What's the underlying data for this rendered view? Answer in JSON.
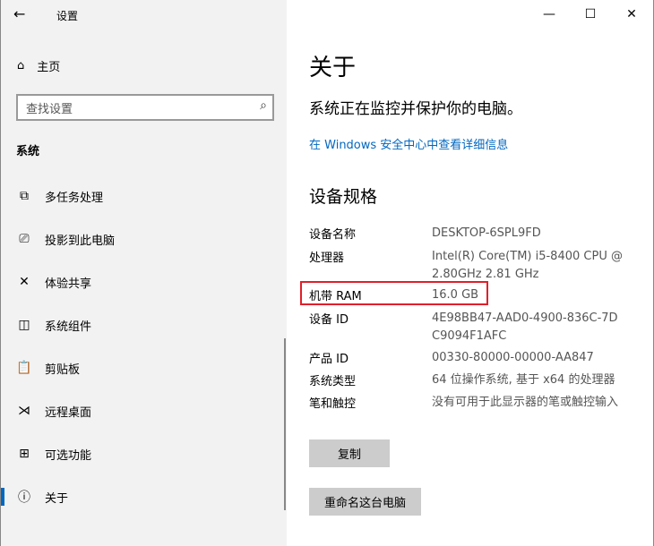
{
  "window": {
    "title": "设置",
    "back_icon": "arrow-left-icon",
    "minimize": "—",
    "maximize": "☐",
    "close": "✕"
  },
  "sidebar": {
    "home": "主页",
    "search_placeholder": "查找设置",
    "section": "系统",
    "items": [
      {
        "label": "多任务处理",
        "icon": "multitask-icon",
        "glyph": "⧉"
      },
      {
        "label": "投影到此电脑",
        "icon": "project-icon",
        "glyph": "⎚"
      },
      {
        "label": "体验共享",
        "icon": "share-icon",
        "glyph": "✕"
      },
      {
        "label": "系统组件",
        "icon": "components-icon",
        "glyph": "◫"
      },
      {
        "label": "剪贴板",
        "icon": "clipboard-icon",
        "glyph": "📋"
      },
      {
        "label": "远程桌面",
        "icon": "remote-icon",
        "glyph": "⋊"
      },
      {
        "label": "可选功能",
        "icon": "features-icon",
        "glyph": "⊞"
      },
      {
        "label": "关于",
        "icon": "info-icon",
        "glyph": "ⓘ"
      }
    ]
  },
  "main": {
    "title": "关于",
    "subtitle": "系统正在监控并保护你的电脑。",
    "link": "在 Windows 安全中心中查看详细信息",
    "spec_title": "设备规格",
    "specs": [
      {
        "k": "设备名称",
        "v": "DESKTOP-6SPL9FD"
      },
      {
        "k": "处理器",
        "v": "Intel(R) Core(TM) i5-8400 CPU @ 2.80GHz   2.81 GHz"
      },
      {
        "k": "机带 RAM",
        "v": "16.0 GB"
      },
      {
        "k": "设备 ID",
        "v": "4E98BB47-AAD0-4900-836C-7DC9094F1AFC"
      },
      {
        "k": "产品 ID",
        "v": "00330-80000-00000-AA847"
      },
      {
        "k": "系统类型",
        "v": "64 位操作系统, 基于 x64 的处理器"
      },
      {
        "k": "笔和触控",
        "v": "没有可用于此显示器的笔或触控输入"
      }
    ],
    "copy": "复制",
    "rename": "重命名这台电脑"
  }
}
